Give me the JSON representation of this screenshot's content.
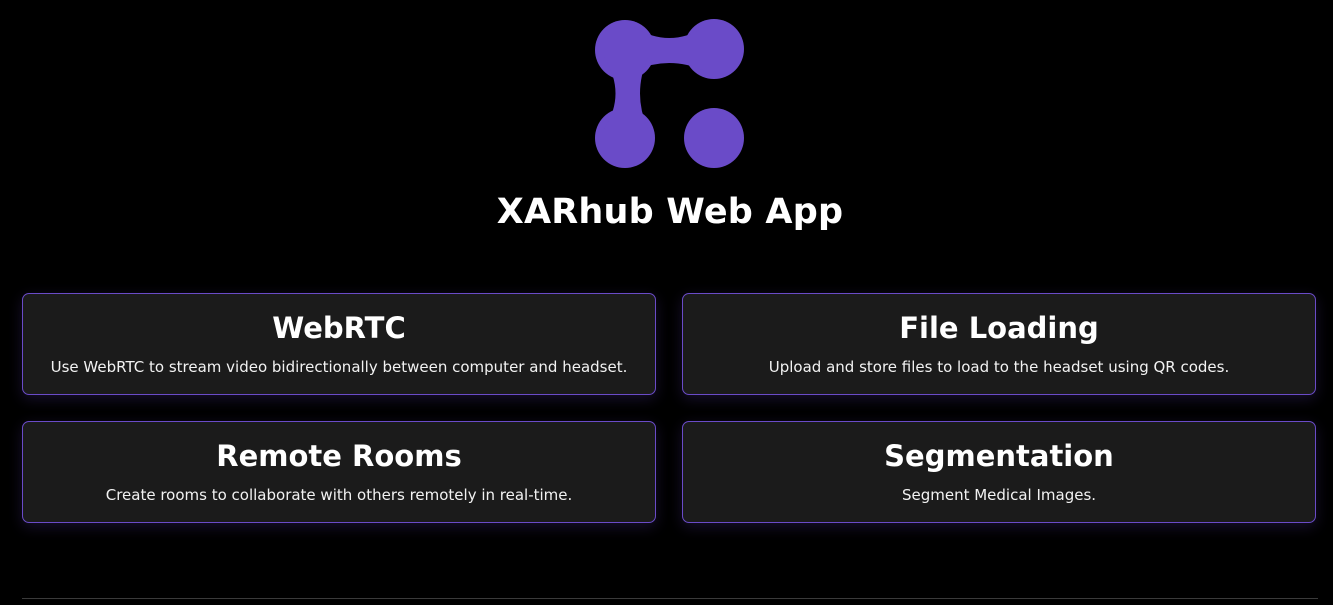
{
  "app": {
    "title": "XARhub Web App",
    "logo_icon": "xarhub-logo-icon",
    "brand_color": "#6a4bc8"
  },
  "cards": [
    {
      "title": "WebRTC",
      "description": "Use WebRTC to stream video bidirectionally between computer and headset."
    },
    {
      "title": "File Loading",
      "description": "Upload and store files to load to the headset using QR codes."
    },
    {
      "title": "Remote Rooms",
      "description": "Create rooms to collaborate with others remotely in real-time."
    },
    {
      "title": "Segmentation",
      "description": "Segment Medical Images."
    }
  ]
}
